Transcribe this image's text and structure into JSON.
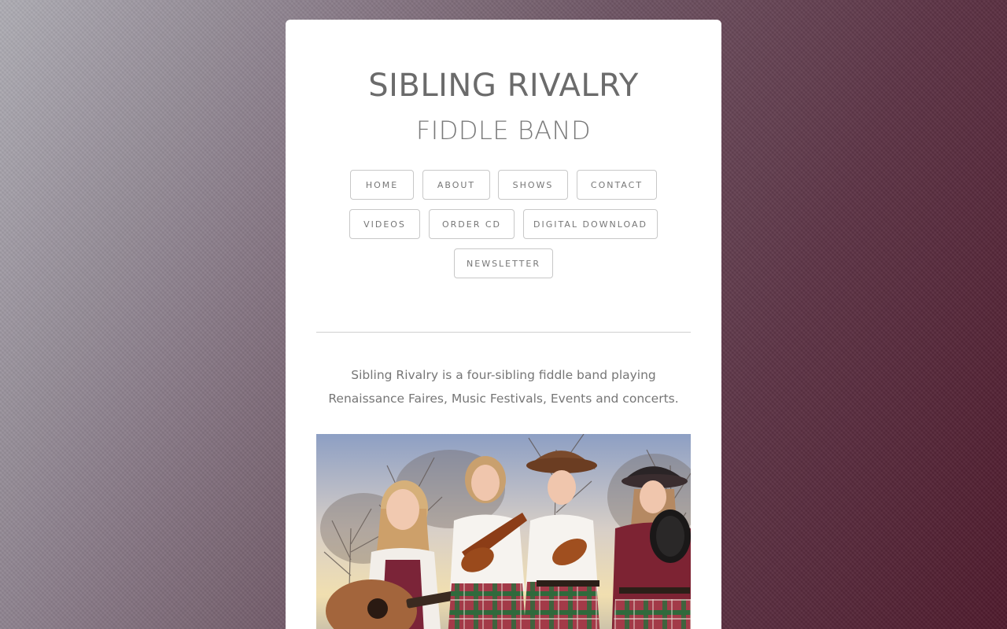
{
  "header": {
    "title": "SIBLING RIVALRY",
    "subtitle": "FIDDLE BAND"
  },
  "nav": {
    "items": [
      {
        "label": "HOME"
      },
      {
        "label": "ABOUT"
      },
      {
        "label": "SHOWS"
      },
      {
        "label": "CONTACT"
      },
      {
        "label": "VIDEOS"
      },
      {
        "label": "ORDER CD"
      },
      {
        "label": "DIGITAL DOWNLOAD"
      },
      {
        "label": "NEWSLETTER"
      }
    ]
  },
  "main": {
    "intro": "Sibling Rivalry is a four-sibling fiddle band playing Renaissance Faires, Music Festivals, Events and concerts."
  },
  "colors": {
    "background_light": "#aeadb4",
    "background_dark": "#4f1a2c",
    "card": "#ffffff",
    "text": "#6b6b6b",
    "button_border": "#c8c8c8"
  }
}
